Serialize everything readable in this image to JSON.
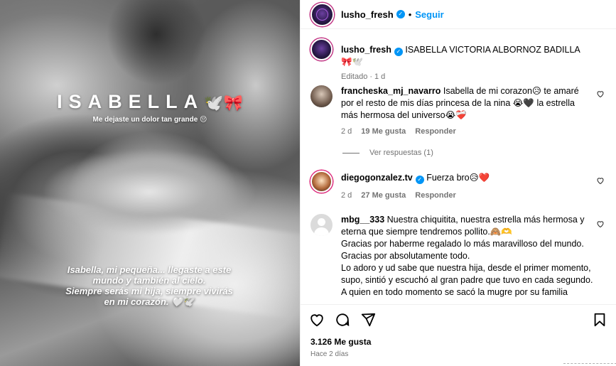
{
  "post_image": {
    "title": "ISABELLA",
    "title_emoji": "🕊️🎀",
    "subtitle": "Me dejaste un dolor tan grande 😔",
    "caption_lines": [
      "Isabella, mi pequeña... llegaste a este",
      "mundo y también al cielo.",
      "Siempre serás mi hija, siempre vivirás",
      "en mi corazón. 🤍🕊️"
    ]
  },
  "header": {
    "username": "lusho_fresh",
    "verified": "✓",
    "separator": "•",
    "follow_label": "Seguir"
  },
  "caption": {
    "username": "lusho_fresh",
    "text": "ISABELLA VICTORIA ALBORNOZ BADILLA 🎀🕊️",
    "meta_edited": "Editado",
    "meta_dot": "·",
    "meta_time": "1 d"
  },
  "comments": [
    {
      "username": "francheska_mj_navarro",
      "text": "Isabella de mi corazon😥 te amaré por el resto de mis días princesa de la nina 😭🖤 la estrella más hermosa del universo😭❤️‍🩹",
      "time": "2 d",
      "likes": "19 Me gusta",
      "reply": "Responder"
    },
    {
      "username": "diegogonzalez.tv",
      "text": "Fuerza bro😥❤️",
      "time": "2 d",
      "likes": "27 Me gusta",
      "reply": "Responder"
    },
    {
      "username": "mbg__333",
      "text_lines": [
        "Nuestra chiquitita, nuestra estrella más hermosa y eterna que siempre tendremos pollito.🙈🫶",
        "Gracias por haberme regalado lo más maravilloso del mundo.",
        "Gracias por absolutamente todo.",
        "Lo adoro y ud sabe que nuestra hija, desde el primer momento, supo, sintió y escuchó al gran padre que tuvo en cada segundo.",
        "A quien en todo momento se sacó la mugre por su familia"
      ]
    }
  ],
  "view_replies": "Ver respuestas (1)",
  "likes_count": "3.126 Me gusta",
  "posted_ago": "Hace 2 días",
  "icons": [
    "heart-icon",
    "comment-icon",
    "share-icon",
    "bookmark-icon"
  ]
}
